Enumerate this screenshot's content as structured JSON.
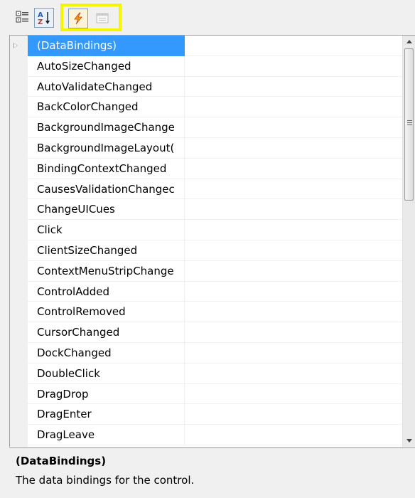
{
  "toolbar": {
    "buttons": [
      {
        "icon": "categorized-icon",
        "active": false
      },
      {
        "icon": "alphabetical-icon",
        "active": true
      },
      {
        "icon": "events-lightning-icon",
        "active": true
      },
      {
        "icon": "property-pages-icon",
        "active": false
      }
    ],
    "highlight_color": "#f5f500"
  },
  "grid": {
    "rows": [
      {
        "name": "(DataBindings)",
        "expandable": true,
        "selected": true
      },
      {
        "name": "AutoSizeChanged"
      },
      {
        "name": "AutoValidateChanged"
      },
      {
        "name": "BackColorChanged"
      },
      {
        "name": "BackgroundImageChange"
      },
      {
        "name": "BackgroundImageLayout("
      },
      {
        "name": "BindingContextChanged"
      },
      {
        "name": "CausesValidationChangec"
      },
      {
        "name": "ChangeUICues"
      },
      {
        "name": "Click"
      },
      {
        "name": "ClientSizeChanged"
      },
      {
        "name": "ContextMenuStripChange"
      },
      {
        "name": "ControlAdded"
      },
      {
        "name": "ControlRemoved"
      },
      {
        "name": "CursorChanged"
      },
      {
        "name": "DockChanged"
      },
      {
        "name": "DoubleClick"
      },
      {
        "name": "DragDrop"
      },
      {
        "name": "DragEnter"
      },
      {
        "name": "DragLeave"
      }
    ],
    "selection_color": "#3399ff"
  },
  "description": {
    "title": "(DataBindings)",
    "text": "The data bindings for the control."
  }
}
